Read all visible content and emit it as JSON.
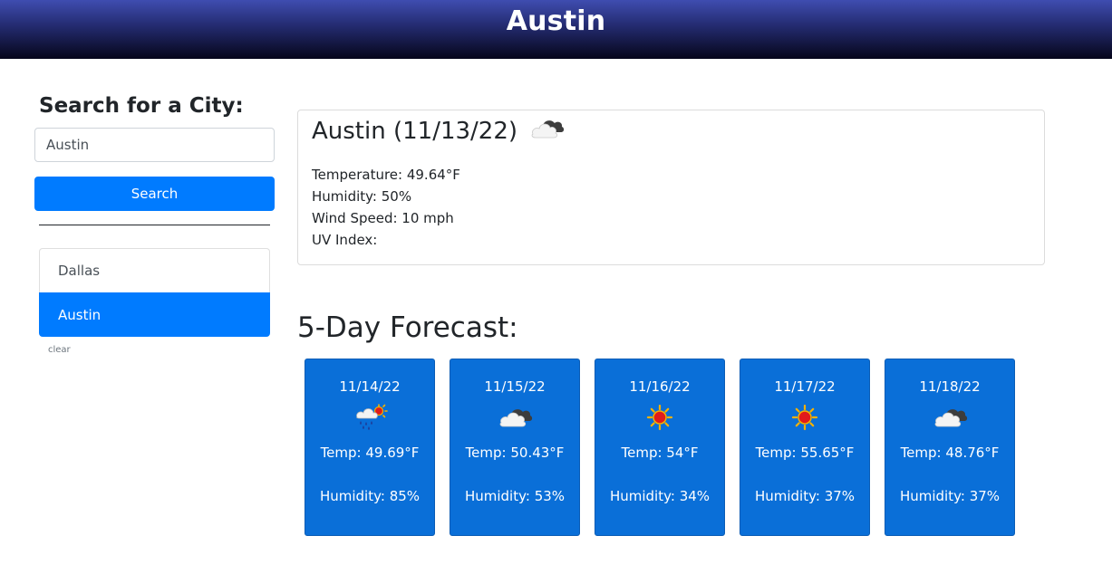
{
  "header": {
    "title": "Austin"
  },
  "search": {
    "heading": "Search for a City:",
    "input_value": "Austin",
    "button_label": "Search",
    "history": [
      "Dallas",
      "Austin"
    ],
    "active_index": 1,
    "clear_label": "clear"
  },
  "current": {
    "title": "Austin (11/13/22)",
    "icon": "broken-clouds-icon",
    "temperature": "Temperature: 49.64°F",
    "humidity": "Humidity: 50%",
    "wind": "Wind Speed: 10 mph",
    "uv": "UV Index:"
  },
  "forecast": {
    "heading": "5-Day Forecast:",
    "days": [
      {
        "date": "11/14/22",
        "icon": "rain-sun-icon",
        "temp": "Temp: 49.69°F",
        "humidity": "Humidity: 85%"
      },
      {
        "date": "11/15/22",
        "icon": "broken-clouds-icon",
        "temp": "Temp: 50.43°F",
        "humidity": "Humidity: 53%"
      },
      {
        "date": "11/16/22",
        "icon": "sun-icon",
        "temp": "Temp: 54°F",
        "humidity": "Humidity: 34%"
      },
      {
        "date": "11/17/22",
        "icon": "sun-icon",
        "temp": "Temp: 55.65°F",
        "humidity": "Humidity: 37%"
      },
      {
        "date": "11/18/22",
        "icon": "broken-clouds-icon",
        "temp": "Temp: 48.76°F",
        "humidity": "Humidity: 37%"
      }
    ]
  },
  "colors": {
    "primary": "#007bff",
    "forecast_card": "#0a6fd8",
    "header_top": "#3f4db0",
    "header_bottom": "#06061a"
  }
}
